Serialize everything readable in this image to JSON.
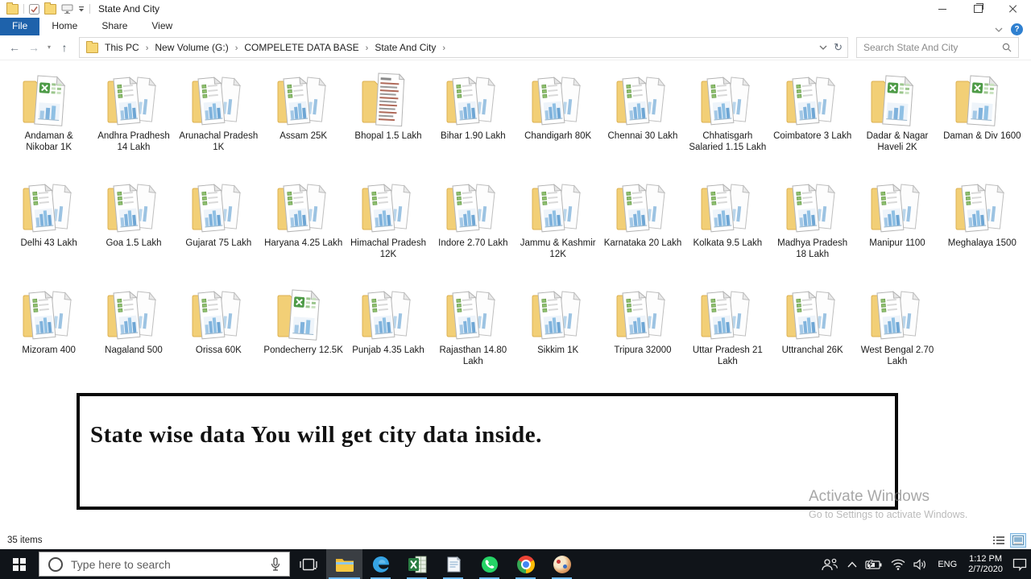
{
  "titlebar": {
    "title": "State And City"
  },
  "ribbon": {
    "tabs": [
      {
        "label": "File",
        "active": true
      },
      {
        "label": "Home",
        "active": false
      },
      {
        "label": "Share",
        "active": false
      },
      {
        "label": "View",
        "active": false
      }
    ],
    "help_glyph": "?"
  },
  "addressbar": {
    "breadcrumb": [
      "This PC",
      "New Volume (G:)",
      "COMPELETE DATA BASE",
      "State And City"
    ],
    "separator": "›",
    "search_placeholder": "Search State And City"
  },
  "folders": [
    {
      "label": "Andaman & Nikobar 1K",
      "icon": "excel"
    },
    {
      "label": "Andhra Pradhesh 14 Lakh",
      "icon": "docs"
    },
    {
      "label": "Arunachal Pradesh 1K",
      "icon": "docs"
    },
    {
      "label": "Assam 25K",
      "icon": "docs"
    },
    {
      "label": "Bhopal 1.5 Lakh",
      "icon": "list"
    },
    {
      "label": "Bihar 1.90 Lakh",
      "icon": "docs"
    },
    {
      "label": "Chandigarh 80K",
      "icon": "docs"
    },
    {
      "label": "Chennai 30 Lakh",
      "icon": "docs"
    },
    {
      "label": "Chhatisgarh Salaried 1.15 Lakh",
      "icon": "docs"
    },
    {
      "label": "Coimbatore 3 Lakh",
      "icon": "docs"
    },
    {
      "label": "Dadar & Nagar Haveli 2K",
      "icon": "excel"
    },
    {
      "label": "Daman & Div 1600",
      "icon": "excel"
    },
    {
      "label": "Delhi 43 Lakh",
      "icon": "docs"
    },
    {
      "label": "Goa 1.5 Lakh",
      "icon": "docs"
    },
    {
      "label": "Gujarat 75 Lakh",
      "icon": "docs"
    },
    {
      "label": "Haryana 4.25 Lakh",
      "icon": "docs"
    },
    {
      "label": "Himachal Pradesh 12K",
      "icon": "docs"
    },
    {
      "label": "Indore 2.70 Lakh",
      "icon": "docs"
    },
    {
      "label": "Jammu & Kashmir 12K",
      "icon": "docs"
    },
    {
      "label": "Karnataka 20 Lakh",
      "icon": "docs"
    },
    {
      "label": "Kolkata 9.5 Lakh",
      "icon": "docs"
    },
    {
      "label": "Madhya Pradesh 18 Lakh",
      "icon": "docs"
    },
    {
      "label": "Manipur 1100",
      "icon": "docs"
    },
    {
      "label": "Meghalaya 1500",
      "icon": "docs"
    },
    {
      "label": "Mizoram 400",
      "icon": "docs"
    },
    {
      "label": "Nagaland 500",
      "icon": "docs"
    },
    {
      "label": "Orissa 60K",
      "icon": "docs"
    },
    {
      "label": "Pondecherry 12.5K",
      "icon": "excel"
    },
    {
      "label": "Punjab 4.35 Lakh",
      "icon": "docs"
    },
    {
      "label": "Rajasthan 14.80 Lakh",
      "icon": "docs"
    },
    {
      "label": "Sikkim 1K",
      "icon": "docs"
    },
    {
      "label": "Tripura 32000",
      "icon": "docs"
    },
    {
      "label": "Uttar Pradesh 21 Lakh",
      "icon": "docs"
    },
    {
      "label": "Uttranchal 26K",
      "icon": "docs"
    },
    {
      "label": "West Bengal 2.70 Lakh",
      "icon": "docs"
    }
  ],
  "banner_text": "State wise data You will get city data inside.",
  "watermark": {
    "title": "Activate Windows",
    "subtitle": "Go to Settings to activate Windows."
  },
  "statusbar": {
    "items": "35 items"
  },
  "taskbar": {
    "search_placeholder": "Type here to search",
    "tray": {
      "language": "ENG",
      "time": "1:12 PM",
      "date": "2/7/2020"
    }
  },
  "colors": {
    "file_tab_blue": "#1e62ab",
    "folder_yellow": "#f2cf76",
    "taskbar_bg": "#101419",
    "running_underline": "#6cb8f0",
    "watermark_gray": "#9f9f9f"
  }
}
